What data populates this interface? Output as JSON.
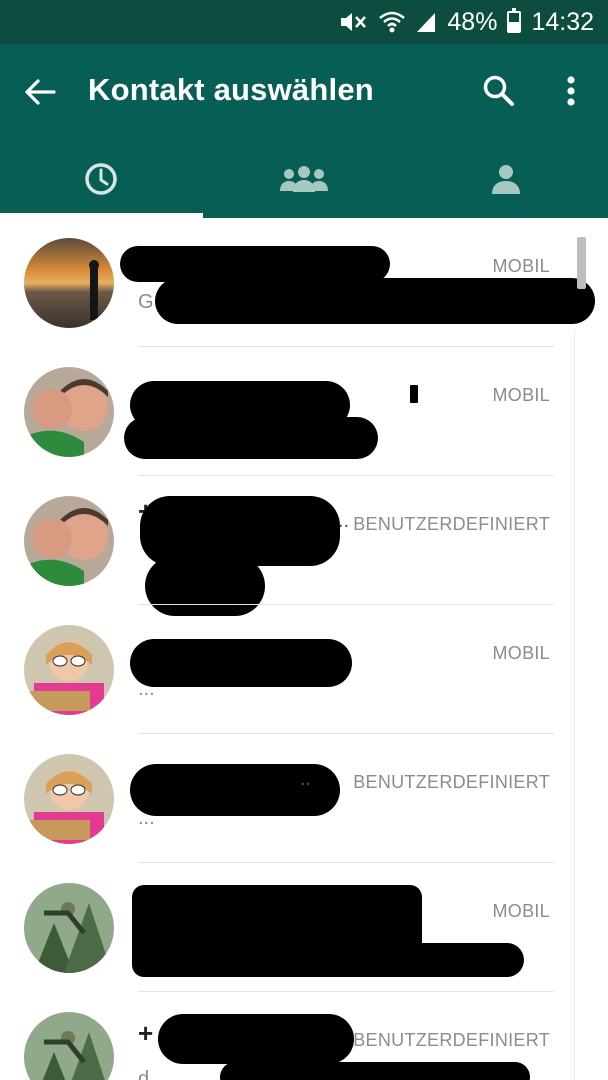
{
  "status_bar": {
    "battery_percent": "48%",
    "battery_level": 0.48,
    "time": "14:32",
    "icons": [
      "mute-icon",
      "wifi-icon",
      "signal-icon",
      "battery-icon"
    ]
  },
  "app_bar": {
    "title": "Kontakt auswählen",
    "icons": [
      "back-arrow-icon",
      "search-icon",
      "more-vertical-icon"
    ]
  },
  "tabs": [
    {
      "name": "recent",
      "icon": "clock-icon",
      "selected": true
    },
    {
      "name": "groups",
      "icon": "group-icon",
      "selected": false
    },
    {
      "name": "contacts",
      "icon": "person-icon",
      "selected": false
    }
  ],
  "contacts": [
    {
      "type": "MOBIL",
      "prefix": "",
      "sub": "G"
    },
    {
      "type": "MOBIL",
      "prefix": "",
      "sub": ""
    },
    {
      "type": "BENUTZERDEFINIERT",
      "prefix": "+",
      "sub": ""
    },
    {
      "type": "MOBIL",
      "prefix": "",
      "sub": "..."
    },
    {
      "type": "BENUTZERDEFINIERT",
      "prefix": "",
      "sub": "..."
    },
    {
      "type": "MOBIL",
      "prefix": "",
      "sub": ""
    },
    {
      "type": "BENUTZERDEFINIERT",
      "prefix": "+",
      "sub": "d"
    }
  ],
  "colors": {
    "status_bar": "#0d4d40",
    "app_bar": "#075e54",
    "label_grey": "#8c8c8c"
  }
}
